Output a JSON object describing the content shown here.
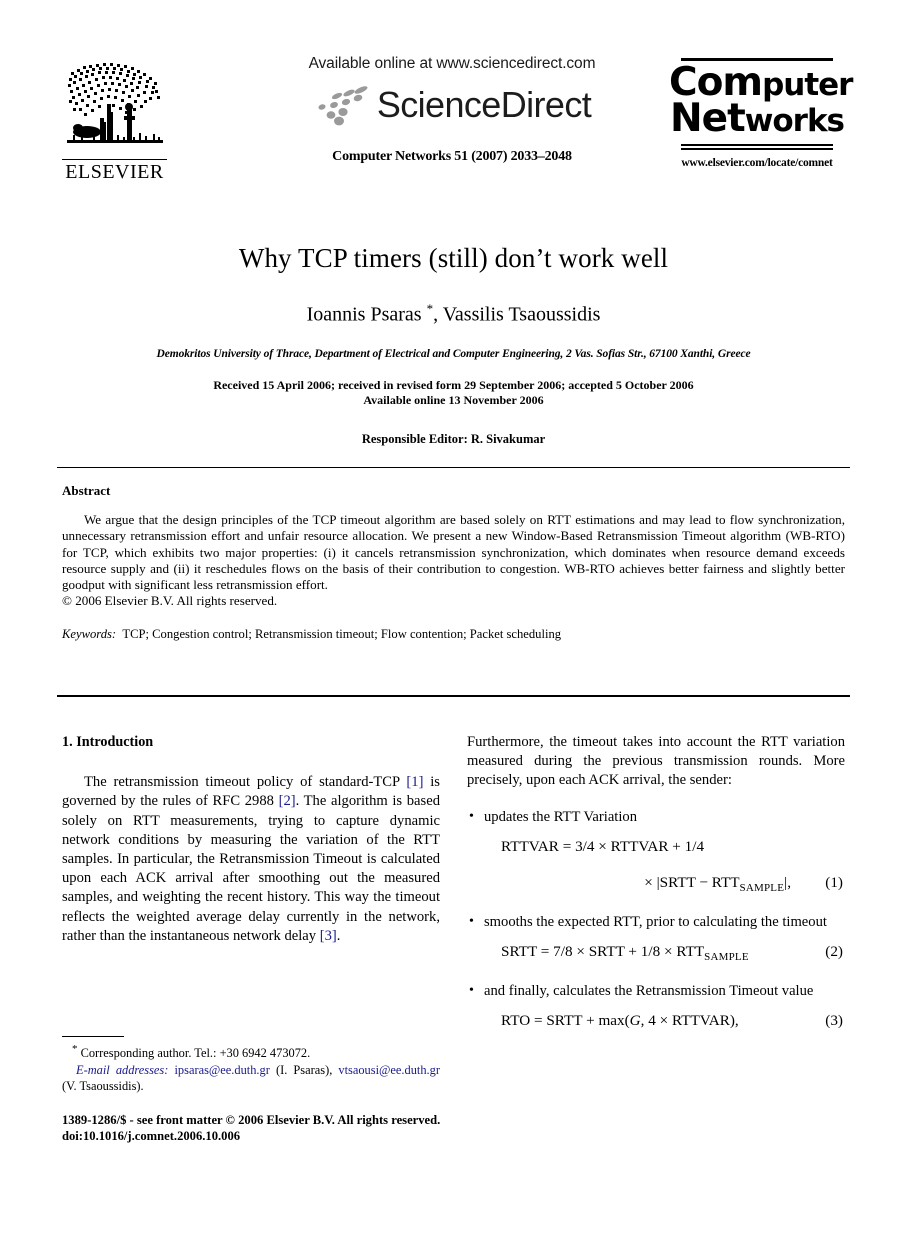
{
  "masthead": {
    "elsevier_wordmark": "ELSEVIER",
    "elsevier_logo_name": "elsevier-tree-logo",
    "available_online": "Available online at www.sciencedirect.com",
    "sciencedirect_wordmark": "ScienceDirect",
    "journal_reference": "Computer Networks 51 (2007) 2033–2048",
    "journal_logo_line1": "Computer",
    "journal_logo_line2": "Networks",
    "journal_logo_line1_big": "Com",
    "journal_logo_line1_small": "puter",
    "journal_logo_line2_big": "Net",
    "journal_logo_line2_small": "works",
    "journal_url": "www.elsevier.com/locate/comnet"
  },
  "title_block": {
    "title": "Why TCP timers (still) don’t work well",
    "authors_part1": "Ioannis Psaras ",
    "authors_star": "*",
    "authors_part2": ", Vassilis Tsaoussidis",
    "affiliation": "Demokritos University of Thrace, Department of Electrical and Computer Engineering, 2 Vas. Sofias Str., 67100 Xanthi, Greece",
    "history_line1": "Received 15 April 2006; received in revised form 29 September 2006; accepted 5 October 2006",
    "history_line2": "Available online 13 November 2006",
    "responsible_editor": "Responsible Editor: R. Sivakumar"
  },
  "abstract": {
    "heading": "Abstract",
    "body": "We argue that the design principles of the TCP timeout algorithm are based solely on RTT estimations and may lead to flow synchronization, unnecessary retransmission effort and unfair resource allocation. We present a new Window-Based Retransmission Timeout algorithm (WB-RTO) for TCP, which exhibits two major properties: (i) it cancels retransmission synchronization, which dominates when resource demand exceeds resource supply and (ii) it reschedules flows on the basis of their contribution to congestion. WB-RTO achieves better fairness and slightly better goodput with significant less retransmission effort.",
    "copyright": "© 2006 Elsevier B.V. All rights reserved.",
    "keywords_label": "Keywords:",
    "keywords_value": "TCP; Congestion control; Retransmission timeout; Flow contention; Packet scheduling"
  },
  "body": {
    "left_column": {
      "section_number_title": "1. Introduction",
      "para_segments": [
        "The retransmission timeout policy of standard-TCP ",
        "[1]",
        " is governed by the rules of RFC 2988 ",
        "[2]",
        ". The algorithm is based solely on RTT measurements, trying to capture dynamic network conditions by measuring the variation of the RTT samples. In particular, the Retransmission Timeout is calculated upon each ACK arrival after smoothing out the measured samples, and weighting the recent history. This way the timeout reflects the weighted average delay currently in the network, rather than the instantaneous network delay ",
        "[3]",
        "."
      ]
    },
    "right_column": {
      "para1": "Furthermore, the timeout takes into account the RTT variation measured during the previous transmission rounds. More precisely, upon each ACK arrival, the sender:",
      "bullets": [
        {
          "text": "updates the RTT Variation"
        },
        {
          "text": "smooths the expected RTT, prior to calculating the timeout"
        },
        {
          "text": "and finally, calculates the Retransmission Timeout value"
        }
      ],
      "equations": [
        {
          "id": "eq1",
          "line1_lhs": "RTTVAR",
          "line1_rel": " = ",
          "line1_rhs": "3/4 × RTTVAR + 1/4",
          "line2_pre": "× |SRTT − RTT",
          "line2_sub": "SAMPLE",
          "line2_post": "|,",
          "number": "(1)"
        },
        {
          "id": "eq2",
          "line1_lhs": "SRTT",
          "line1_rel": " = ",
          "line1_rhs_pre": "7/8 × SRTT + 1/8 × RTT",
          "line1_sub": "SAMPLE",
          "number": "(2)"
        },
        {
          "id": "eq3",
          "line1_lhs": "RTO",
          "line1_rel": " = ",
          "line1_rhs_pre": "SRTT + max(",
          "line1_ital": "G",
          "line1_rhs_post": ", 4 × RTTVAR),",
          "number": "(3)"
        }
      ]
    }
  },
  "footnote": {
    "star": "*",
    "corresponding": " Corresponding author. Tel.: +30 6942 473072.",
    "email_label": "E-mail addresses:",
    "email1": "ipsaras@ee.duth.gr",
    "email1_owner": " (I. Psaras), ",
    "email2": "vtsaousi@ee.duth.gr",
    "email2_owner": " (V. Tsaoussidis).",
    "issn_line": "1389-1286/$ - see front matter © 2006 Elsevier B.V. All rights reserved.",
    "doi_line": "doi:10.1016/j.comnet.2006.10.006"
  },
  "colors": {
    "link": "#1a1a8c",
    "text": "#000000",
    "background": "#ffffff"
  }
}
